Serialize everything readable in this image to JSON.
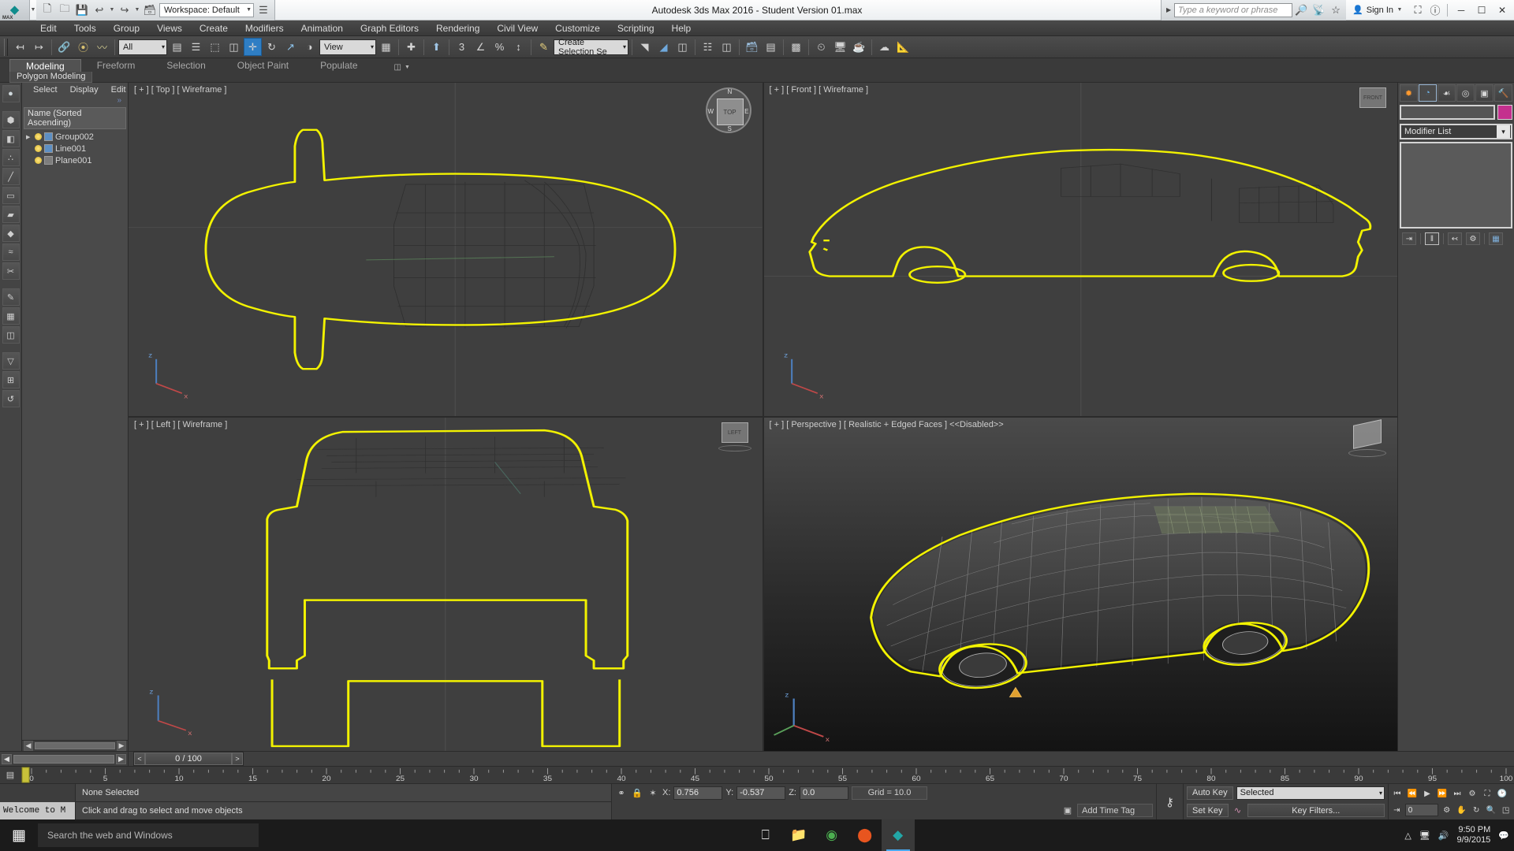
{
  "titlebar": {
    "app_title": "Autodesk 3ds Max 2016 - Student Version   01.max",
    "max_logo_label": "MAX",
    "workspace_label": "Workspace: Default",
    "search_placeholder": "Type a keyword or phrase",
    "sign_in": "Sign In",
    "quick_access": [
      {
        "name": "new-file",
        "glyph": "❐"
      },
      {
        "name": "open-file",
        "glyph": "🗁"
      },
      {
        "name": "save-file",
        "glyph": "💾"
      },
      {
        "name": "undo",
        "glyph": "↩"
      },
      {
        "name": "redo",
        "glyph": "↪"
      },
      {
        "name": "project-folder",
        "glyph": "🗂"
      }
    ],
    "title_icons": [
      {
        "name": "binoculars-icon",
        "glyph": "🔎"
      },
      {
        "name": "satellite-icon",
        "glyph": "📡"
      },
      {
        "name": "star-favorites-icon",
        "glyph": "☆"
      },
      {
        "name": "help-circle-icon",
        "glyph": "?"
      }
    ],
    "window_buttons": [
      {
        "name": "minimize-button",
        "glyph": "─"
      },
      {
        "name": "maximize-button",
        "glyph": "□"
      },
      {
        "name": "close-button",
        "glyph": "✕"
      }
    ]
  },
  "menubar": {
    "items": [
      "Edit",
      "Tools",
      "Group",
      "Views",
      "Create",
      "Modifiers",
      "Animation",
      "Graph Editors",
      "Rendering",
      "Civil View",
      "Customize",
      "Scripting",
      "Help"
    ]
  },
  "toolbar": {
    "selection_filter": "All",
    "reference_coord": "View",
    "named_selection_set": "Create Selection Se",
    "angle_snap_value": "3",
    "buttons": [
      {
        "name": "undo-scene-button",
        "glyph": "↩"
      },
      {
        "name": "redo-scene-button",
        "glyph": "↪"
      },
      {
        "name": "select-and-link-button",
        "glyph": "🔗"
      },
      {
        "name": "unlink-selection-button",
        "glyph": "⛓"
      },
      {
        "name": "bind-to-space-warp-button",
        "glyph": "〰"
      },
      {
        "name": "select-object-button",
        "glyph": "⬚"
      },
      {
        "name": "select-by-name-button",
        "glyph": "☰"
      },
      {
        "name": "rectangular-region-button",
        "glyph": "⬚"
      },
      {
        "name": "window-crossing-button",
        "glyph": "❐"
      },
      {
        "name": "select-and-move-button",
        "glyph": "✛"
      },
      {
        "name": "select-and-rotate-button",
        "glyph": "↻"
      },
      {
        "name": "select-and-scale-button",
        "glyph": "⤡"
      },
      {
        "name": "select-and-place-button",
        "glyph": "◑"
      },
      {
        "name": "mirror-button",
        "glyph": "◧"
      },
      {
        "name": "align-button",
        "glyph": "⊥"
      },
      {
        "name": "layer-explorer-button",
        "glyph": "⬆"
      },
      {
        "name": "angle-snap-toggle",
        "glyph": "∠"
      },
      {
        "name": "percent-snap-toggle",
        "glyph": "%"
      },
      {
        "name": "spinner-snap-toggle",
        "glyph": "↕"
      },
      {
        "name": "edit-named-selection-button",
        "glyph": "✏"
      },
      {
        "name": "curve-editor-button",
        "glyph": "↗"
      },
      {
        "name": "schematic-view-button",
        "glyph": "◩"
      },
      {
        "name": "material-editor-button",
        "glyph": "▤"
      },
      {
        "name": "render-setup-button",
        "glyph": "🎬"
      },
      {
        "name": "render-frame-button",
        "glyph": "🖥"
      },
      {
        "name": "render-production-button",
        "glyph": "🫖"
      }
    ]
  },
  "ribbon": {
    "tabs": [
      {
        "label": "Modeling",
        "active": true
      },
      {
        "label": "Freeform",
        "active": false
      },
      {
        "label": "Selection",
        "active": false
      },
      {
        "label": "Object Paint",
        "active": false
      },
      {
        "label": "Populate",
        "active": false
      }
    ],
    "panel_label": "Polygon Modeling"
  },
  "explorer": {
    "menu": [
      "Select",
      "Display",
      "Edit"
    ],
    "expand_chevron": "»",
    "column_header": "Name (Sorted Ascending)",
    "items": [
      {
        "name": "Group002",
        "has_children": true,
        "type": "group"
      },
      {
        "name": "Line001",
        "has_children": false,
        "type": "shape"
      },
      {
        "name": "Plane001",
        "has_children": false,
        "type": "geometry"
      }
    ]
  },
  "left_toolbar": {
    "buttons": [
      {
        "name": "create-panel-icon",
        "glyph": "⬤"
      },
      {
        "name": "ngon-icon",
        "glyph": "⬢"
      },
      {
        "name": "edit-poly-icon",
        "glyph": "◧"
      },
      {
        "name": "vertex-icon",
        "glyph": "∴"
      },
      {
        "name": "edge-icon",
        "glyph": "╱"
      },
      {
        "name": "border-icon",
        "glyph": "▭"
      },
      {
        "name": "polygon-icon",
        "glyph": "▰"
      },
      {
        "name": "element-icon",
        "glyph": "◆"
      },
      {
        "name": "swift-loop-icon",
        "glyph": "≈"
      },
      {
        "name": "cut-icon",
        "glyph": "✂"
      },
      {
        "name": "paint-connect-icon",
        "glyph": "✎"
      },
      {
        "name": "generate-topology-icon",
        "glyph": "▦"
      },
      {
        "name": "symmetry-icon",
        "glyph": "◫"
      },
      {
        "name": "preserve-uvs-icon",
        "glyph": "▤"
      },
      {
        "name": "constraints-icon",
        "glyph": "▽"
      },
      {
        "name": "align-grid-icon",
        "glyph": "⊞"
      },
      {
        "name": "repeat-last-icon",
        "glyph": "↺"
      }
    ]
  },
  "viewports": [
    {
      "id": "top",
      "label": "[ + ] [ Top ] [ Wireframe ]",
      "active": false,
      "widget": "viewcube",
      "widget_label": "TOP",
      "compass": [
        "N",
        "E",
        "S",
        "W"
      ]
    },
    {
      "id": "front",
      "label": "[ + ] [ Front ] [ Wireframe ]",
      "active": false,
      "widget": "viewcube",
      "widget_label": "FRONT"
    },
    {
      "id": "left",
      "label": "[ + ] [ Left ] [ Wireframe ]",
      "active": false,
      "widget": "viewcube",
      "widget_label": "LEFT"
    },
    {
      "id": "perspective",
      "label": "[ + ] [ Perspective ] [ Realistic + Edged Faces ]  <<Disabled>>",
      "active": true,
      "widget": "viewcube",
      "widget_label": ""
    }
  ],
  "command_panel": {
    "tabs": [
      {
        "name": "create-tab",
        "glyph": "✹",
        "active": false
      },
      {
        "name": "modify-tab",
        "glyph": "◜",
        "active": true
      },
      {
        "name": "hierarchy-tab",
        "glyph": "☴",
        "active": false
      },
      {
        "name": "motion-tab",
        "glyph": "◎",
        "active": false
      },
      {
        "name": "display-tab",
        "glyph": "▣",
        "active": false
      },
      {
        "name": "utilities-tab",
        "glyph": "🔨",
        "active": false
      }
    ],
    "object_name": "",
    "object_color": "#c4308e",
    "modifier_list_label": "Modifier List",
    "stack_items": [],
    "stack_buttons": [
      {
        "name": "pin-stack-button",
        "glyph": "⇥"
      },
      {
        "name": "show-end-result-button",
        "glyph": "‖"
      },
      {
        "name": "make-unique-button",
        "glyph": "⑂"
      },
      {
        "name": "remove-modifier-button",
        "glyph": "🗑"
      },
      {
        "name": "configure-modifier-sets-button",
        "glyph": "▦"
      }
    ]
  },
  "timeline": {
    "frame_display": "0 / 100",
    "prev_arrow": "<",
    "next_arrow": ">",
    "ruler_start": 0,
    "ruler_end": 100,
    "ruler_major_step": 5,
    "ruler_ticks": [
      0,
      5,
      10,
      15,
      20,
      25,
      30,
      35,
      40,
      45,
      50,
      55,
      60,
      65,
      70,
      75,
      80,
      85,
      90,
      95,
      100
    ],
    "current_frame": 0
  },
  "statusbar": {
    "welcome_text": "Welcome to M",
    "selection_status": "None Selected",
    "prompt_text": "Click and drag to select and move objects",
    "coords": [
      {
        "label": "X:",
        "value": "0.756"
      },
      {
        "label": "Y:",
        "value": "-0.537"
      },
      {
        "label": "Z:",
        "value": "0.0"
      }
    ],
    "grid_text": "Grid = 10.0",
    "add_time_tag": "Add Time Tag",
    "auto_key": "Auto Key",
    "set_key": "Set Key",
    "key_mode": "Selected",
    "key_filters": "Key Filters...",
    "spinner_value": "0",
    "status_icons": [
      {
        "name": "isolate-selection-icon",
        "glyph": "♁"
      },
      {
        "name": "lock-selection-icon",
        "glyph": "🔒"
      },
      {
        "name": "transform-center-icon",
        "glyph": "✲"
      },
      {
        "name": "key-icon",
        "glyph": "⚷"
      }
    ],
    "playback_buttons": [
      {
        "name": "goto-start-button",
        "glyph": "⏮"
      },
      {
        "name": "previous-frame-button",
        "glyph": "⏪"
      },
      {
        "name": "play-animation-button",
        "glyph": "▶"
      },
      {
        "name": "next-frame-button",
        "glyph": "⏩"
      },
      {
        "name": "goto-end-button",
        "glyph": "⏭"
      },
      {
        "name": "time-configuration-button",
        "glyph": "⌚"
      },
      {
        "name": "zoom-extents-all-button",
        "glyph": "⛶"
      },
      {
        "name": "max-viewport-toggle-button",
        "glyph": "❐"
      },
      {
        "name": "pan-view-button",
        "glyph": "✋"
      },
      {
        "name": "orbit-button",
        "glyph": "↻"
      },
      {
        "name": "zoom-button",
        "glyph": "🔍"
      },
      {
        "name": "field-of-view-button",
        "glyph": "◳"
      }
    ]
  },
  "taskbar": {
    "start_label": "⊞",
    "search_placeholder": "Search the web and Windows",
    "apps": [
      {
        "name": "task-view-button",
        "glyph": "❑",
        "active": false
      },
      {
        "name": "file-explorer-button",
        "glyph": "📁",
        "active": false
      },
      {
        "name": "chrome-button",
        "glyph": "◉",
        "active": false
      },
      {
        "name": "opera-button",
        "glyph": "●",
        "active": false
      },
      {
        "name": "3dsmax-taskbar-button",
        "glyph": "⬟",
        "active": true
      }
    ],
    "time": "9:50 PM",
    "date": "9/9/2015",
    "tray_icons": [
      {
        "name": "show-hidden-icons",
        "glyph": "⌃"
      },
      {
        "name": "network-icon",
        "glyph": "🖥"
      },
      {
        "name": "volume-icon",
        "glyph": "🔊"
      }
    ]
  }
}
